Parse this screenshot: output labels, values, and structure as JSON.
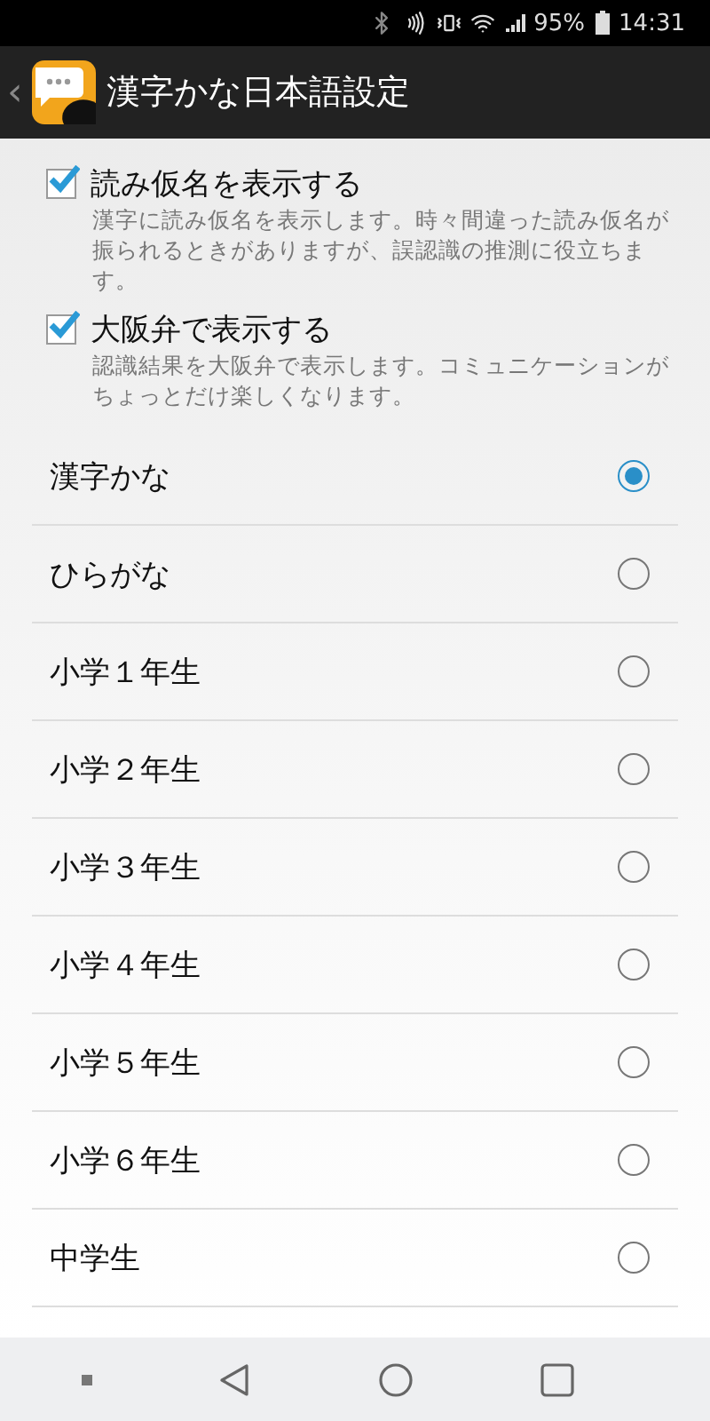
{
  "status_bar": {
    "battery": "95%",
    "time": "14:31"
  },
  "app_bar": {
    "back": "‹",
    "title": "漢字かな日本語設定"
  },
  "options": [
    {
      "title": "読み仮名を表示する",
      "description": "漢字に読み仮名を表示します。時々間違った読み仮名が振られるときがありますが、誤認識の推測に役立ちます。",
      "checked": true
    },
    {
      "title": "大阪弁で表示する",
      "description": "認識結果を大阪弁で表示します。コミュニケーションがちょっとだけ楽しくなります。",
      "checked": true
    }
  ],
  "levels": [
    {
      "label": "漢字かな",
      "selected": true
    },
    {
      "label": "ひらがな",
      "selected": false
    },
    {
      "label": "小学１年生",
      "selected": false
    },
    {
      "label": "小学２年生",
      "selected": false
    },
    {
      "label": "小学３年生",
      "selected": false
    },
    {
      "label": "小学４年生",
      "selected": false
    },
    {
      "label": "小学５年生",
      "selected": false
    },
    {
      "label": "小学６年生",
      "selected": false
    },
    {
      "label": "中学生",
      "selected": false
    }
  ]
}
